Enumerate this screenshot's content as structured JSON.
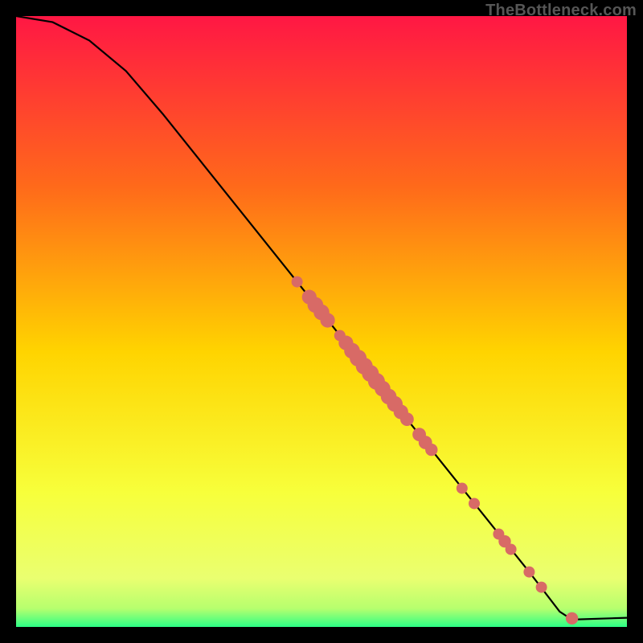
{
  "attribution": "TheBottleneck.com",
  "colors": {
    "frame": "#000000",
    "curve": "#000000",
    "marker_fill": "#d86a66",
    "marker_stroke": "#b24c49",
    "gradient_top": "#ff1744",
    "gradient_mid1": "#ff6a1a",
    "gradient_mid2": "#ffd400",
    "gradient_mid3": "#f7ff3b",
    "gradient_band": "#eaff70",
    "gradient_bottom": "#2cff86"
  },
  "chart_data": {
    "type": "line",
    "title": "",
    "xlabel": "",
    "ylabel": "",
    "xlim": [
      0,
      100
    ],
    "ylim": [
      0,
      100
    ],
    "grid": false,
    "curve": [
      {
        "x": 0,
        "y": 100
      },
      {
        "x": 6,
        "y": 99
      },
      {
        "x": 12,
        "y": 96
      },
      {
        "x": 18,
        "y": 91
      },
      {
        "x": 24,
        "y": 84
      },
      {
        "x": 30,
        "y": 76.5
      },
      {
        "x": 36,
        "y": 69
      },
      {
        "x": 42,
        "y": 61.5
      },
      {
        "x": 48,
        "y": 54
      },
      {
        "x": 54,
        "y": 46.5
      },
      {
        "x": 60,
        "y": 39
      },
      {
        "x": 66,
        "y": 31.5
      },
      {
        "x": 72,
        "y": 24
      },
      {
        "x": 78,
        "y": 16.5
      },
      {
        "x": 84,
        "y": 9
      },
      {
        "x": 89,
        "y": 2.5
      },
      {
        "x": 91,
        "y": 1.2
      },
      {
        "x": 100,
        "y": 1.5
      }
    ],
    "markers": [
      {
        "x": 46,
        "y": 56.5,
        "r": 1.0
      },
      {
        "x": 48,
        "y": 54.0,
        "r": 1.3
      },
      {
        "x": 49,
        "y": 52.7,
        "r": 1.4
      },
      {
        "x": 50,
        "y": 51.5,
        "r": 1.4
      },
      {
        "x": 51,
        "y": 50.2,
        "r": 1.3
      },
      {
        "x": 53,
        "y": 47.7,
        "r": 1.0
      },
      {
        "x": 54,
        "y": 46.5,
        "r": 1.3
      },
      {
        "x": 55,
        "y": 45.2,
        "r": 1.4
      },
      {
        "x": 56,
        "y": 44.0,
        "r": 1.5
      },
      {
        "x": 57,
        "y": 42.7,
        "r": 1.5
      },
      {
        "x": 58,
        "y": 41.5,
        "r": 1.5
      },
      {
        "x": 59,
        "y": 40.2,
        "r": 1.5
      },
      {
        "x": 60,
        "y": 39.0,
        "r": 1.4
      },
      {
        "x": 61,
        "y": 37.7,
        "r": 1.4
      },
      {
        "x": 62,
        "y": 36.5,
        "r": 1.4
      },
      {
        "x": 63,
        "y": 35.2,
        "r": 1.3
      },
      {
        "x": 64,
        "y": 34.0,
        "r": 1.2
      },
      {
        "x": 66,
        "y": 31.5,
        "r": 1.2
      },
      {
        "x": 67,
        "y": 30.2,
        "r": 1.2
      },
      {
        "x": 68,
        "y": 29.0,
        "r": 1.1
      },
      {
        "x": 73,
        "y": 22.7,
        "r": 1.0
      },
      {
        "x": 75,
        "y": 20.2,
        "r": 1.0
      },
      {
        "x": 79,
        "y": 15.2,
        "r": 1.0
      },
      {
        "x": 80,
        "y": 14.0,
        "r": 1.1
      },
      {
        "x": 81,
        "y": 12.7,
        "r": 1.0
      },
      {
        "x": 84,
        "y": 9.0,
        "r": 1.0
      },
      {
        "x": 86,
        "y": 6.5,
        "r": 1.0
      },
      {
        "x": 91,
        "y": 1.4,
        "r": 1.1
      }
    ]
  }
}
